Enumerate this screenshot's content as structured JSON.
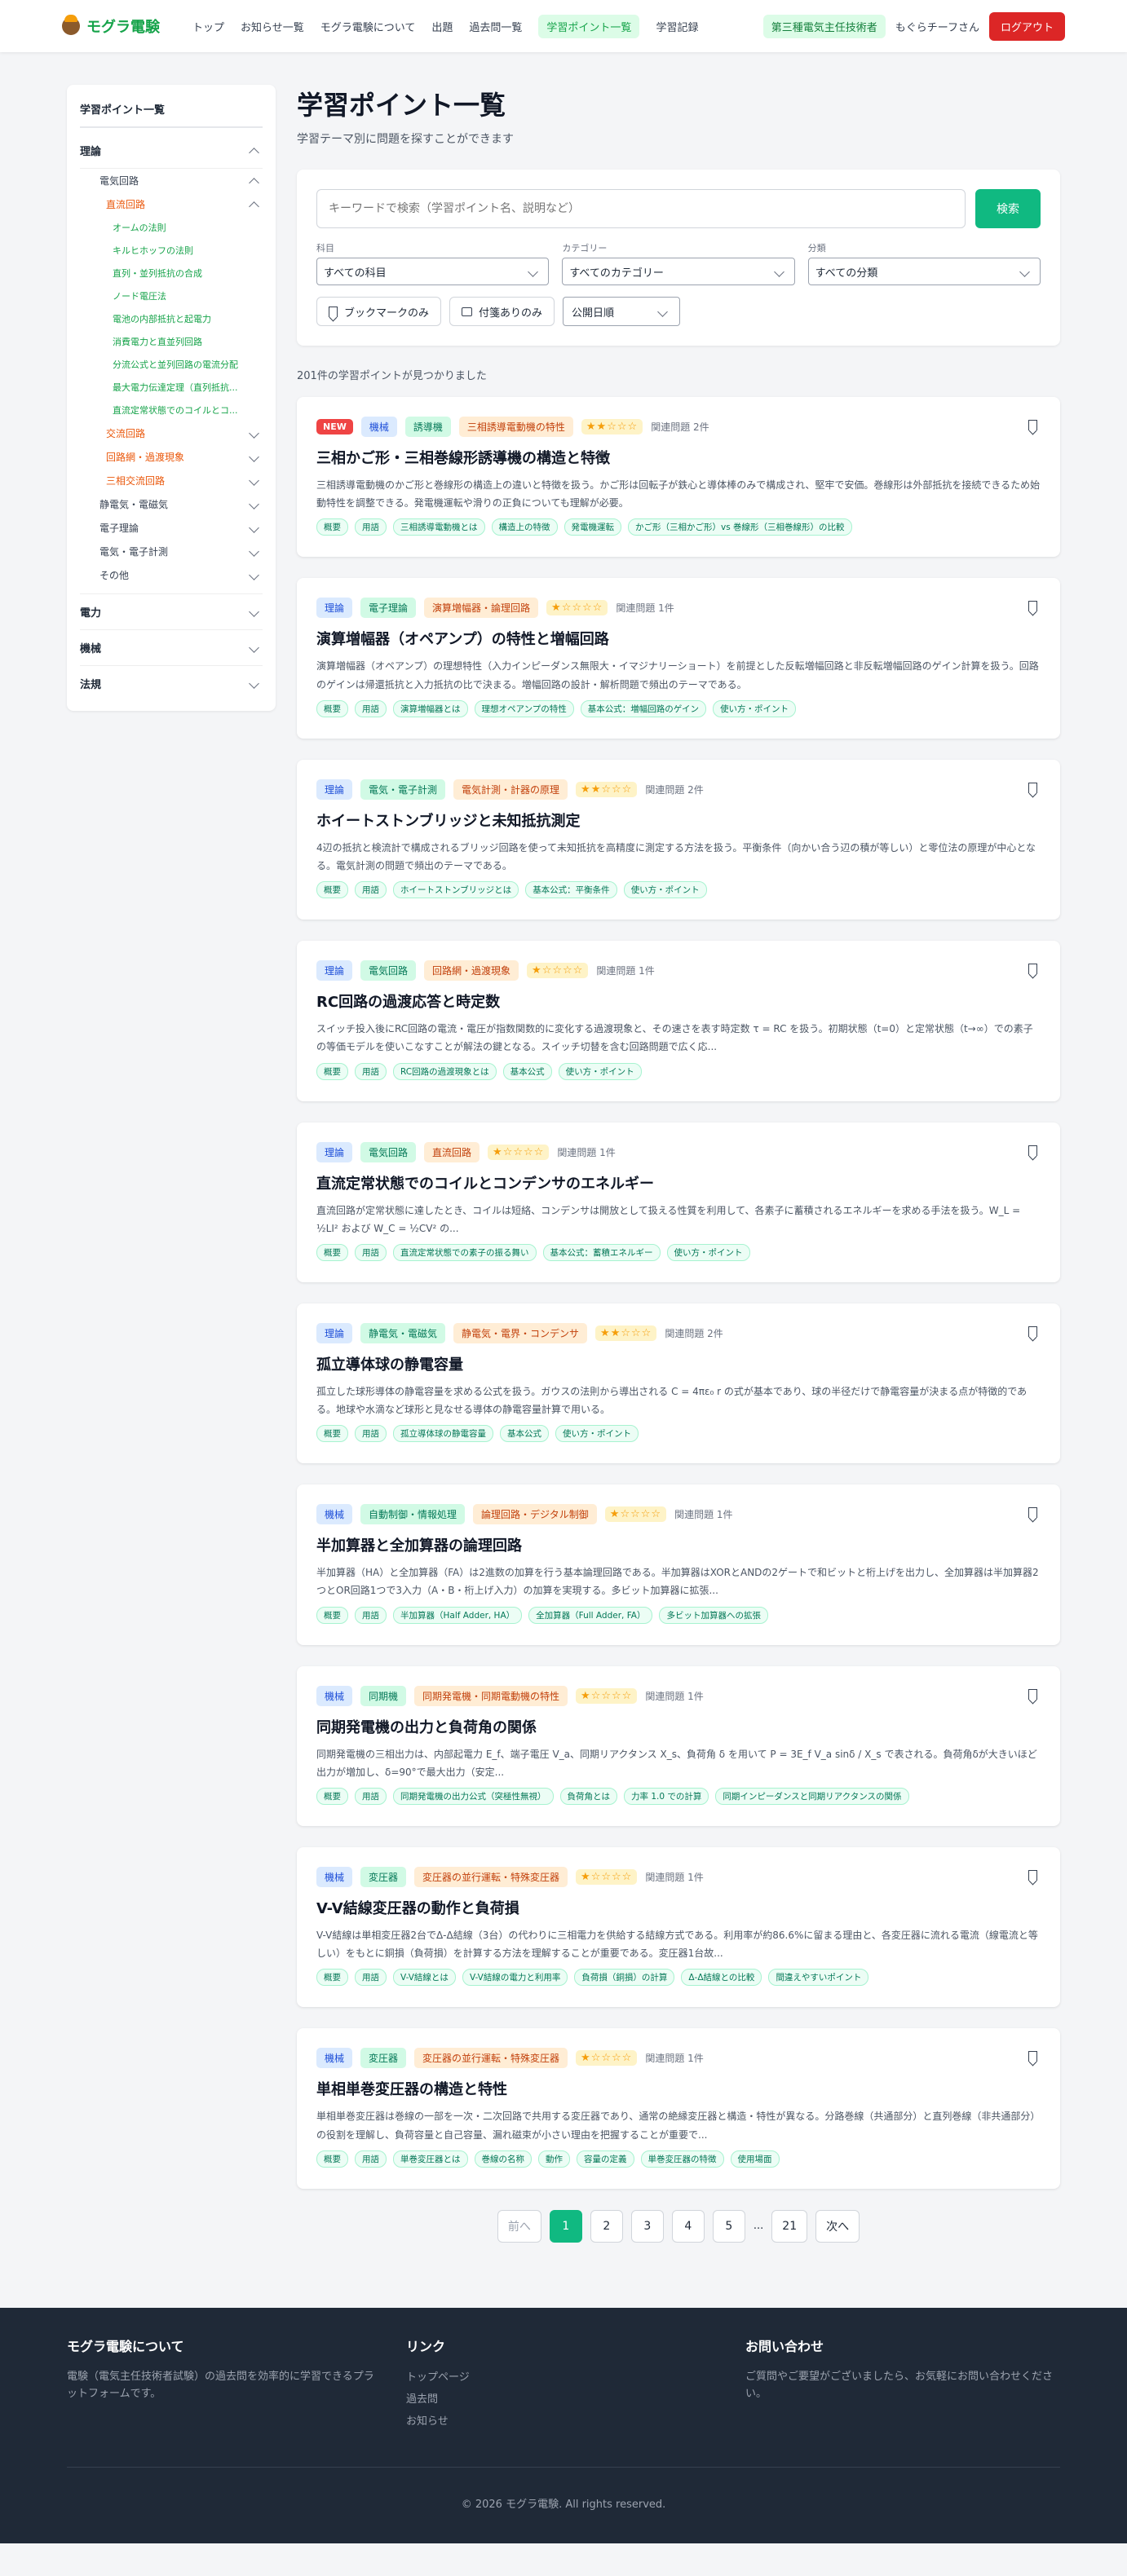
{
  "header": {
    "logo_text": "モグラ電験",
    "nav": [
      "トップ",
      "お知らせ一覧",
      "モグラ電験について",
      "出題",
      "過去問一覧",
      "学習ポイント一覧",
      "学習記録"
    ],
    "active_index": 5,
    "role_badge": "第三種電気主任技術者",
    "username": "もぐらチーフさん",
    "logout": "ログアウト"
  },
  "sidebar": {
    "title": "学習ポイント一覧",
    "theory": "理論",
    "circuits": "電気回路",
    "dc": "直流回路",
    "dc_items": [
      "オームの法則",
      "キルヒホッフの法則",
      "直列・並列抵抗の合成",
      "ノード電圧法",
      "電池の内部抵抗と起電力",
      "消費電力と直並列回路",
      "分流公式と並列回路の電流分配",
      "最大電力伝達定理（直列抵抗...",
      "直流定常状態でのコイルとコ..."
    ],
    "ac": "交流回路",
    "transient": "回路網・過渡現象",
    "three_phase": "三相交流回路",
    "others": [
      "静電気・電磁気",
      "電子理論",
      "電気・電子計測",
      "その他"
    ],
    "top_cats": [
      "電力",
      "機械",
      "法規"
    ]
  },
  "main": {
    "title": "学習ポイント一覧",
    "subtitle": "学習テーマ別に問題を探すことができます",
    "search_placeholder": "キーワードで検索（学習ポイント名、説明など）",
    "search_button": "検索",
    "filters": [
      {
        "label": "科目",
        "value": "すべての科目"
      },
      {
        "label": "カテゴリー",
        "value": "すべてのカテゴリー"
      },
      {
        "label": "分類",
        "value": "すべての分類"
      }
    ],
    "bookmark_only": "ブックマークのみ",
    "notes_only": "付箋ありのみ",
    "sort": "公開日順",
    "result_count": "201件の学習ポイントが見つかりました"
  },
  "cards": [
    {
      "new": "NEW",
      "subject": "機械",
      "category": "誘導機",
      "class": "三相誘導電動機の特性",
      "stars": "★★☆☆☆",
      "related": "関連問題 2件",
      "title": "三相かご形・三相巻線形誘導機の構造と特徴",
      "desc": "三相誘導電動機のかご形と巻線形の構造上の違いと特徴を扱う。かご形は回転子が鉄心と導体棒のみで構成され、堅牢で安価。巻線形は外部抵抗を接続できるため始動特性を調整できる。発電機運転や滑りの正負についても理解が必要。",
      "keywords": [
        "概要",
        "用語",
        "三相誘導電動機とは",
        "構造上の特徴",
        "発電機運転",
        "かご形（三相かご形）vs 巻線形（三相巻線形）の比較"
      ]
    },
    {
      "new": "",
      "subject": "理論",
      "category": "電子理論",
      "class": "演算増幅器・論理回路",
      "stars": "★☆☆☆☆",
      "related": "関連問題 1件",
      "title": "演算増幅器（オペアンプ）の特性と増幅回路",
      "desc": "演算増幅器（オペアンプ）の理想特性（入力インピーダンス無限大・イマジナリーショート）を前提とした反転増幅回路と非反転増幅回路のゲイン計算を扱う。回路のゲインは帰還抵抗と入力抵抗の比で決まる。増幅回路の設計・解析問題で頻出のテーマである。",
      "keywords": [
        "概要",
        "用語",
        "演算増幅器とは",
        "理想オペアンプの特性",
        "基本公式：増幅回路のゲイン",
        "使い方・ポイント"
      ]
    },
    {
      "new": "",
      "subject": "理論",
      "category": "電気・電子計測",
      "class": "電気計測・計器の原理",
      "stars": "★★☆☆☆",
      "related": "関連問題 2件",
      "title": "ホイートストンブリッジと未知抵抗測定",
      "desc": "4辺の抵抗と検流計で構成されるブリッジ回路を使って未知抵抗を高精度に測定する方法を扱う。平衡条件（向かい合う辺の積が等しい）と零位法の原理が中心となる。電気計測の問題で頻出のテーマである。",
      "keywords": [
        "概要",
        "用語",
        "ホイートストンブリッジとは",
        "基本公式：平衡条件",
        "使い方・ポイント"
      ]
    },
    {
      "new": "",
      "subject": "理論",
      "category": "電気回路",
      "class": "回路網・過渡現象",
      "stars": "★☆☆☆☆",
      "related": "関連問題 1件",
      "title": "RC回路の過渡応答と時定数",
      "desc": "スイッチ投入後にRC回路の電流・電圧が指数関数的に変化する過渡現象と、その速さを表す時定数 τ = RC を扱う。初期状態（t=0）と定常状態（t→∞）での素子の等価モデルを使いこなすことが解法の鍵となる。スイッチ切替を含む回路問題で広く応...",
      "keywords": [
        "概要",
        "用語",
        "RC回路の過渡現象とは",
        "基本公式",
        "使い方・ポイント"
      ]
    },
    {
      "new": "",
      "subject": "理論",
      "category": "電気回路",
      "class": "直流回路",
      "stars": "★☆☆☆☆",
      "related": "関連問題 1件",
      "title": "直流定常状態でのコイルとコンデンサのエネルギー",
      "desc": "直流回路が定常状態に達したとき、コイルは短絡、コンデンサは開放として扱える性質を利用して、各素子に蓄積されるエネルギーを求める手法を扱う。W_L = ½LI² および W_C = ½CV² の...",
      "keywords": [
        "概要",
        "用語",
        "直流定常状態での素子の振る舞い",
        "基本公式：蓄積エネルギー",
        "使い方・ポイント"
      ]
    },
    {
      "new": "",
      "subject": "理論",
      "category": "静電気・電磁気",
      "class": "静電気・電界・コンデンサ",
      "stars": "★★☆☆☆",
      "related": "関連問題 2件",
      "title": "孤立導体球の静電容量",
      "desc": "孤立した球形導体の静電容量を求める公式を扱う。ガウスの法則から導出される C = 4πε₀ r の式が基本であり、球の半径だけで静電容量が決まる点が特徴的である。地球や水滴など球形と見なせる導体の静電容量計算で用いる。",
      "keywords": [
        "概要",
        "用語",
        "孤立導体球の静電容量",
        "基本公式",
        "使い方・ポイント"
      ]
    },
    {
      "new": "",
      "subject": "機械",
      "category": "自動制御・情報処理",
      "class": "論理回路・デジタル制御",
      "stars": "★☆☆☆☆",
      "related": "関連問題 1件",
      "title": "半加算器と全加算器の論理回路",
      "desc": "半加算器（HA）と全加算器（FA）は2進数の加算を行う基本論理回路である。半加算器はXORとANDの2ゲートで和ビットと桁上げを出力し、全加算器は半加算器2つとOR回路1つで3入力（A・B・桁上げ入力）の加算を実現する。多ビット加算器に拡張...",
      "keywords": [
        "概要",
        "用語",
        "半加算器（Half Adder, HA）",
        "全加算器（Full Adder, FA）",
        "多ビット加算器への拡張"
      ]
    },
    {
      "new": "",
      "subject": "機械",
      "category": "同期機",
      "class": "同期発電機・同期電動機の特性",
      "stars": "★☆☆☆☆",
      "related": "関連問題 1件",
      "title": "同期発電機の出力と負荷角の関係",
      "desc": "同期発電機の三相出力は、内部起電力 E_f、端子電圧 V_a、同期リアクタンス X_s、負荷角 δ を用いて P = 3E_f V_a sinδ / X_s で表される。負荷角δが大きいほど出力が増加し、δ=90°で最大出力（安定...",
      "keywords": [
        "概要",
        "用語",
        "同期発電機の出力公式（突極性無視）",
        "負荷角とは",
        "力率 1.0 での計算",
        "同期インピーダンスと同期リアクタンスの関係"
      ]
    },
    {
      "new": "",
      "subject": "機械",
      "category": "変圧器",
      "class": "変圧器の並行運転・特殊変圧器",
      "stars": "★☆☆☆☆",
      "related": "関連問題 1件",
      "title": "V-V結線変圧器の動作と負荷損",
      "desc": "V-V結線は単相変圧器2台でΔ-Δ結線（3台）の代わりに三相電力を供給する結線方式である。利用率が約86.6%に留まる理由と、各変圧器に流れる電流（線電流と等しい）をもとに銅損（負荷損）を計算する方法を理解することが重要である。変圧器1台故...",
      "keywords": [
        "概要",
        "用語",
        "V-V結線とは",
        "V-V結線の電力と利用率",
        "負荷損（銅損）の計算",
        "Δ-Δ結線との比較",
        "間違えやすいポイント"
      ]
    },
    {
      "new": "",
      "subject": "機械",
      "category": "変圧器",
      "class": "変圧器の並行運転・特殊変圧器",
      "stars": "★☆☆☆☆",
      "related": "関連問題 1件",
      "title": "単相単巻変圧器の構造と特性",
      "desc": "単相単巻変圧器は巻線の一部を一次・二次回路で共用する変圧器であり、通常の絶縁変圧器と構造・特性が異なる。分路巻線（共通部分）と直列巻線（非共通部分）の役割を理解し、負荷容量と自己容量、漏れ磁束が小さい理由を把握することが重要で...",
      "keywords": [
        "概要",
        "用語",
        "単巻変圧器とは",
        "巻線の名称",
        "動作",
        "容量の定義",
        "単巻変圧器の特徴",
        "使用場面"
      ]
    }
  ],
  "pagination": {
    "prev": "前へ",
    "pages": [
      "1",
      "2",
      "3",
      "4",
      "5"
    ],
    "ellipsis": "...",
    "last": "21",
    "next": "次へ"
  },
  "footer": {
    "about_title": "モグラ電験について",
    "about_text": "電験（電気主任技術者試験）の過去問を効率的に学習できるプラットフォームです。",
    "links_title": "リンク",
    "links": [
      "トップページ",
      "過去問",
      "お知らせ"
    ],
    "contact_title": "お問い合わせ",
    "contact_text": "ご質問やご要望がございましたら、お気軽にお問い合わせください。",
    "copyright": "© 2026 モグラ電験. All rights reserved."
  }
}
